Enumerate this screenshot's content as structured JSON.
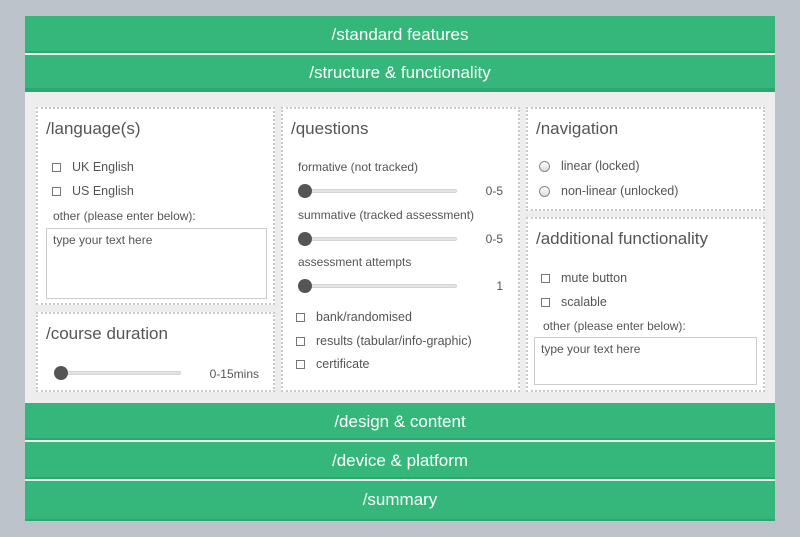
{
  "sections": {
    "standard_features": "/standard features",
    "structure_functionality": "/structure & functionality",
    "design_content": "/design & content",
    "device_platform": "/device & platform",
    "summary": "/summary"
  },
  "language": {
    "title": "/language(s)",
    "options": [
      "UK English",
      "US English"
    ],
    "other_label": "other (please enter below):",
    "placeholder": "type your text here"
  },
  "course_duration": {
    "title": "/course duration",
    "slider_value": 0,
    "range_label": "0-15mins"
  },
  "questions": {
    "title": "/questions",
    "sliders": [
      {
        "label": "formative (not tracked)",
        "value": 0,
        "range_label": "0-5"
      },
      {
        "label": "summative (tracked assessment)",
        "value": 0,
        "range_label": "0-5"
      },
      {
        "label": "assessment attempts",
        "value": 0,
        "range_label": "1"
      }
    ],
    "options": [
      "bank/randomised",
      "results (tabular/info-graphic)",
      "certificate"
    ]
  },
  "navigation": {
    "title": "/navigation",
    "options": [
      "linear (locked)",
      "non-linear (unlocked)"
    ]
  },
  "additional": {
    "title": "/additional functionality",
    "options": [
      "mute button",
      "scalable"
    ],
    "other_label": "other (please enter below):",
    "placeholder": "type your text here"
  },
  "colors": {
    "accent": "#35b77c",
    "background": "#bcc3ca",
    "panel_bg": "#ededed"
  }
}
